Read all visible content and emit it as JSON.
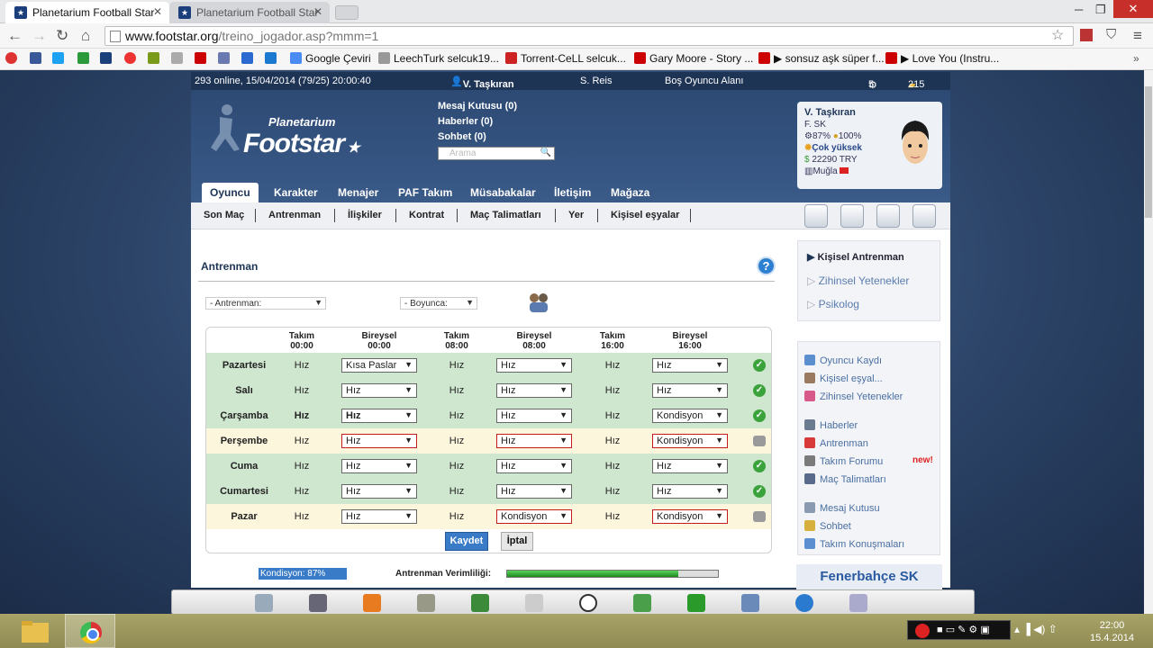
{
  "browser": {
    "tabs": [
      {
        "label": "Planetarium Football Star",
        "active": true
      },
      {
        "label": "Planetarium Football Star",
        "active": false
      }
    ],
    "url_host": "www.footstar.org",
    "url_path": "/treino_jogador.asp?mmm=1",
    "bookmarks": [
      {
        "label": "Google Çeviri",
        "color": "#4a8af4"
      },
      {
        "label": "LeechTurk selcuk19...",
        "color": "#999999"
      },
      {
        "label": "Torrent-CeLL selcuk...",
        "color": "#cc2222"
      },
      {
        "label": "Gary Moore - Story ...",
        "color": "#cc0000"
      },
      {
        "label": "▶ sonsuz aşk süper f...",
        "color": "#cc0000"
      },
      {
        "label": "▶ Love You (Instru...",
        "color": "#cc0000"
      }
    ]
  },
  "site": {
    "status": "293 online, 15/04/2014 (79/25) 20:00:40",
    "user": "V. Taşkıran",
    "team_short": "S. Reis",
    "empty_area": "Boş Oyuncu Alanı",
    "count1": "5",
    "count2": "215",
    "logo_top": "Planetarium",
    "logo_main": "Footstar",
    "header_links": [
      "Mesaj Kutusu (0)",
      "Haberler (0)",
      "Sohbet (0)"
    ],
    "search_placeholder": "Arama",
    "profile": {
      "name": "V. Taşkıran",
      "club": "F. SK",
      "stat1": "87%",
      "stat2": "100%",
      "mood": "Çok yüksek",
      "money": "22290 TRY",
      "city": "Muğla"
    },
    "main_tabs": [
      "Oyuncu",
      "Karakter",
      "Menajer",
      "PAF Takım",
      "Müsabakalar",
      "İletişim",
      "Mağaza"
    ],
    "sub_tabs": [
      "Son Maç",
      "Antrenman",
      "İlişkiler",
      "Kontrat",
      "Maç Talimatları",
      "Yer",
      "Kişisel eşyalar"
    ]
  },
  "training": {
    "title": "Antrenman",
    "filter1": "- Antrenman:",
    "filter2": "- Boyunca:",
    "headers": [
      {
        "l1": "Takım",
        "l2": "00:00"
      },
      {
        "l1": "Bireysel",
        "l2": "00:00"
      },
      {
        "l1": "Takım",
        "l2": "08:00"
      },
      {
        "l1": "Bireysel",
        "l2": "08:00"
      },
      {
        "l1": "Takım",
        "l2": "16:00"
      },
      {
        "l1": "Bireysel",
        "l2": "16:00"
      }
    ],
    "rows": [
      {
        "day": "Pazartesi",
        "t1": "Hız",
        "b1": "Kısa Paslar",
        "t2": "Hız",
        "b2": "Hız",
        "t3": "Hız",
        "b3": "Hız",
        "status": "ok"
      },
      {
        "day": "Salı",
        "t1": "Hız",
        "b1": "Hız",
        "t2": "Hız",
        "b2": "Hız",
        "t3": "Hız",
        "b3": "Hız",
        "status": "ok"
      },
      {
        "day": "Çarşamba",
        "t1": "Hız",
        "b1": "Hız",
        "t2": "Hız",
        "b2": "Hız",
        "t3": "Hız",
        "b3": "Kondisyon",
        "status": "ok"
      },
      {
        "day": "Perşembe",
        "t1": "Hız",
        "b1": "Hız",
        "t2": "Hız",
        "b2": "Hız",
        "t3": "Hız",
        "b3": "Kondisyon",
        "status": "pending"
      },
      {
        "day": "Cuma",
        "t1": "Hız",
        "b1": "Hız",
        "t2": "Hız",
        "b2": "Hız",
        "t3": "Hız",
        "b3": "Hız",
        "status": "ok"
      },
      {
        "day": "Cumartesi",
        "t1": "Hız",
        "b1": "Hız",
        "t2": "Hız",
        "b2": "Hız",
        "t3": "Hız",
        "b3": "Hız",
        "status": "ok"
      },
      {
        "day": "Pazar",
        "t1": "Hız",
        "b1": "Hız",
        "t2": "Hız",
        "b2": "Kondisyon",
        "t3": "Hız",
        "b3": "Kondisyon",
        "status": "pending"
      }
    ],
    "save": "Kaydet",
    "cancel": "İptal",
    "condition": "Kondisyon: 87%",
    "efficiency_label": "Antrenman Verimliliği:",
    "efficiency": 0.81
  },
  "sidebar": {
    "training_menu": [
      "Kişisel Antrenman",
      "Zihinsel Yetenekler",
      "Psikolog"
    ],
    "links1": [
      {
        "label": "Oyuncu Kaydı",
        "color": "#5b8fd0"
      },
      {
        "label": "Kişisel eşyal...",
        "color": "#9a7a60"
      },
      {
        "label": "Zihinsel Yetenekler",
        "color": "#d85a8a"
      }
    ],
    "links2": [
      {
        "label": "Haberler",
        "color": "#6a7a90"
      },
      {
        "label": "Antrenman",
        "color": "#d83a3a"
      },
      {
        "label": "Takım Forumu",
        "color": "#7a7a7a"
      },
      {
        "label": "Maç Talimatları",
        "color": "#5a6a8a"
      }
    ],
    "new_badge": "new!",
    "links3": [
      {
        "label": "Mesaj Kutusu",
        "color": "#8a9ab0"
      },
      {
        "label": "Sohbet",
        "color": "#d8b040"
      },
      {
        "label": "Takım Konuşmaları",
        "color": "#5b8fd0"
      }
    ],
    "club": "Fenerbahçe SK"
  },
  "taskbar": {
    "time": "22:00",
    "date": "15.4.2014"
  }
}
